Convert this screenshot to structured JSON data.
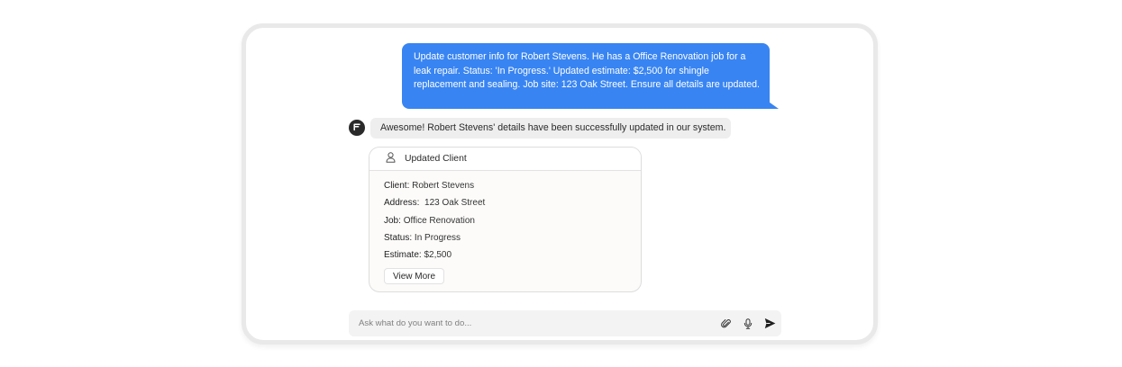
{
  "chat": {
    "user_message": "Update customer info for Robert Stevens. He has a Office Renovation job for a leak repair. Status: 'In Progress.' Updated estimate: $2,500 for shingle replacement and sealing. Job site: 123 Oak Street. Ensure all details are updated.",
    "bot_message": "Awesome! Robert Stevens' details have been successfully updated in our system."
  },
  "card": {
    "title": "Updated Client",
    "fields": [
      {
        "label": "Client:",
        "value": "Robert Stevens"
      },
      {
        "label": "Address:",
        "value": " 123 Oak Street"
      },
      {
        "label": "Job:",
        "value": "Office Renovation"
      },
      {
        "label": "Status:",
        "value": "In Progress"
      },
      {
        "label": "Estimate:",
        "value": "$2,500"
      }
    ],
    "button_label": "View More"
  },
  "composer": {
    "placeholder": "Ask what do you want to do...",
    "value": ""
  },
  "icons": {
    "avatar": "brand-logo-icon",
    "card": "user-icon",
    "attach": "paperclip-icon",
    "mic": "microphone-icon",
    "send": "send-icon"
  },
  "colors": {
    "user_bubble": "#3884f2",
    "bot_bubble": "#eeeeee",
    "card_bg": "#fcfbfa",
    "composer_bg": "#f3f3f3"
  }
}
